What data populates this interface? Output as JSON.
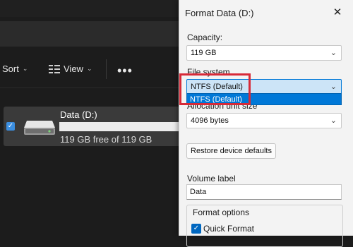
{
  "toolbar": {
    "sort_label": "Sort",
    "view_label": "View",
    "more_label": "•••"
  },
  "drive": {
    "name": "Data (D:)",
    "free_text": "119 GB free of 119 GB",
    "used_fraction": 0.0
  },
  "dialog": {
    "title": "Format Data (D:)",
    "close": "✕",
    "capacity_label": "Capacity:",
    "capacity_value": "119 GB",
    "filesystem_label": "File system",
    "filesystem_value": "NTFS (Default)",
    "filesystem_options": [
      "NTFS (Default)"
    ],
    "allocation_label": "Allocation unit size",
    "allocation_value": "4096 bytes",
    "restore_button": "Restore device defaults",
    "volume_label": "Volume label",
    "volume_value": "Data",
    "format_options_label": "Format options",
    "quick_format_label": "Quick Format",
    "quick_format_checked": true
  },
  "colors": {
    "highlight_box": "#d72a38",
    "selection": "#0078d7",
    "explorer_bg": "#1c1c1c"
  },
  "icons": {
    "checkbox": "checkmark-icon",
    "dropdown": "chevron-down-icon",
    "close": "close-icon",
    "drive": "hard-drive-icon",
    "view": "view-lines-icon"
  }
}
